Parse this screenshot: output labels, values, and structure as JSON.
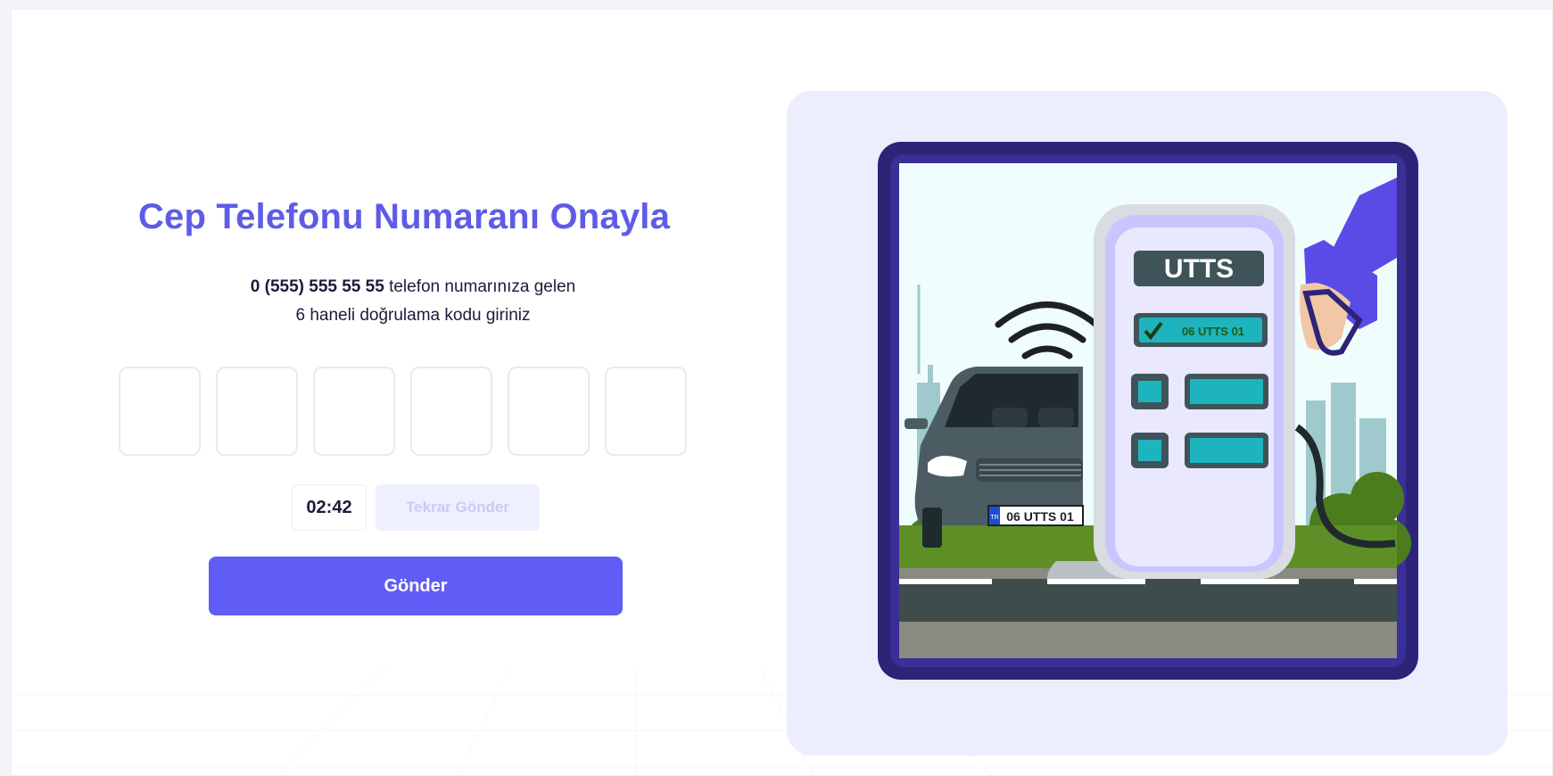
{
  "verify": {
    "title": "Cep Telefonu Numaranı Onayla",
    "phone": "0 (555) 555 55 55",
    "line1_rest": " telefon numarınıza gelen",
    "line2": "6 haneli doğrulama kodu giriniz",
    "code_length": 6,
    "timer": "02:42",
    "resend_label": "Tekrar Gönder",
    "submit_label": "Gönder"
  },
  "illustration": {
    "pump_brand": "UTTS",
    "display_plate": "06 UTTS 01",
    "car_plate": "06 UTTS 01",
    "plate_country": "TR"
  },
  "colors": {
    "accent": "#615cf5",
    "title": "#5e5ce6",
    "panel_bg": "#ecedfd",
    "frame_border": "#2d2377"
  }
}
